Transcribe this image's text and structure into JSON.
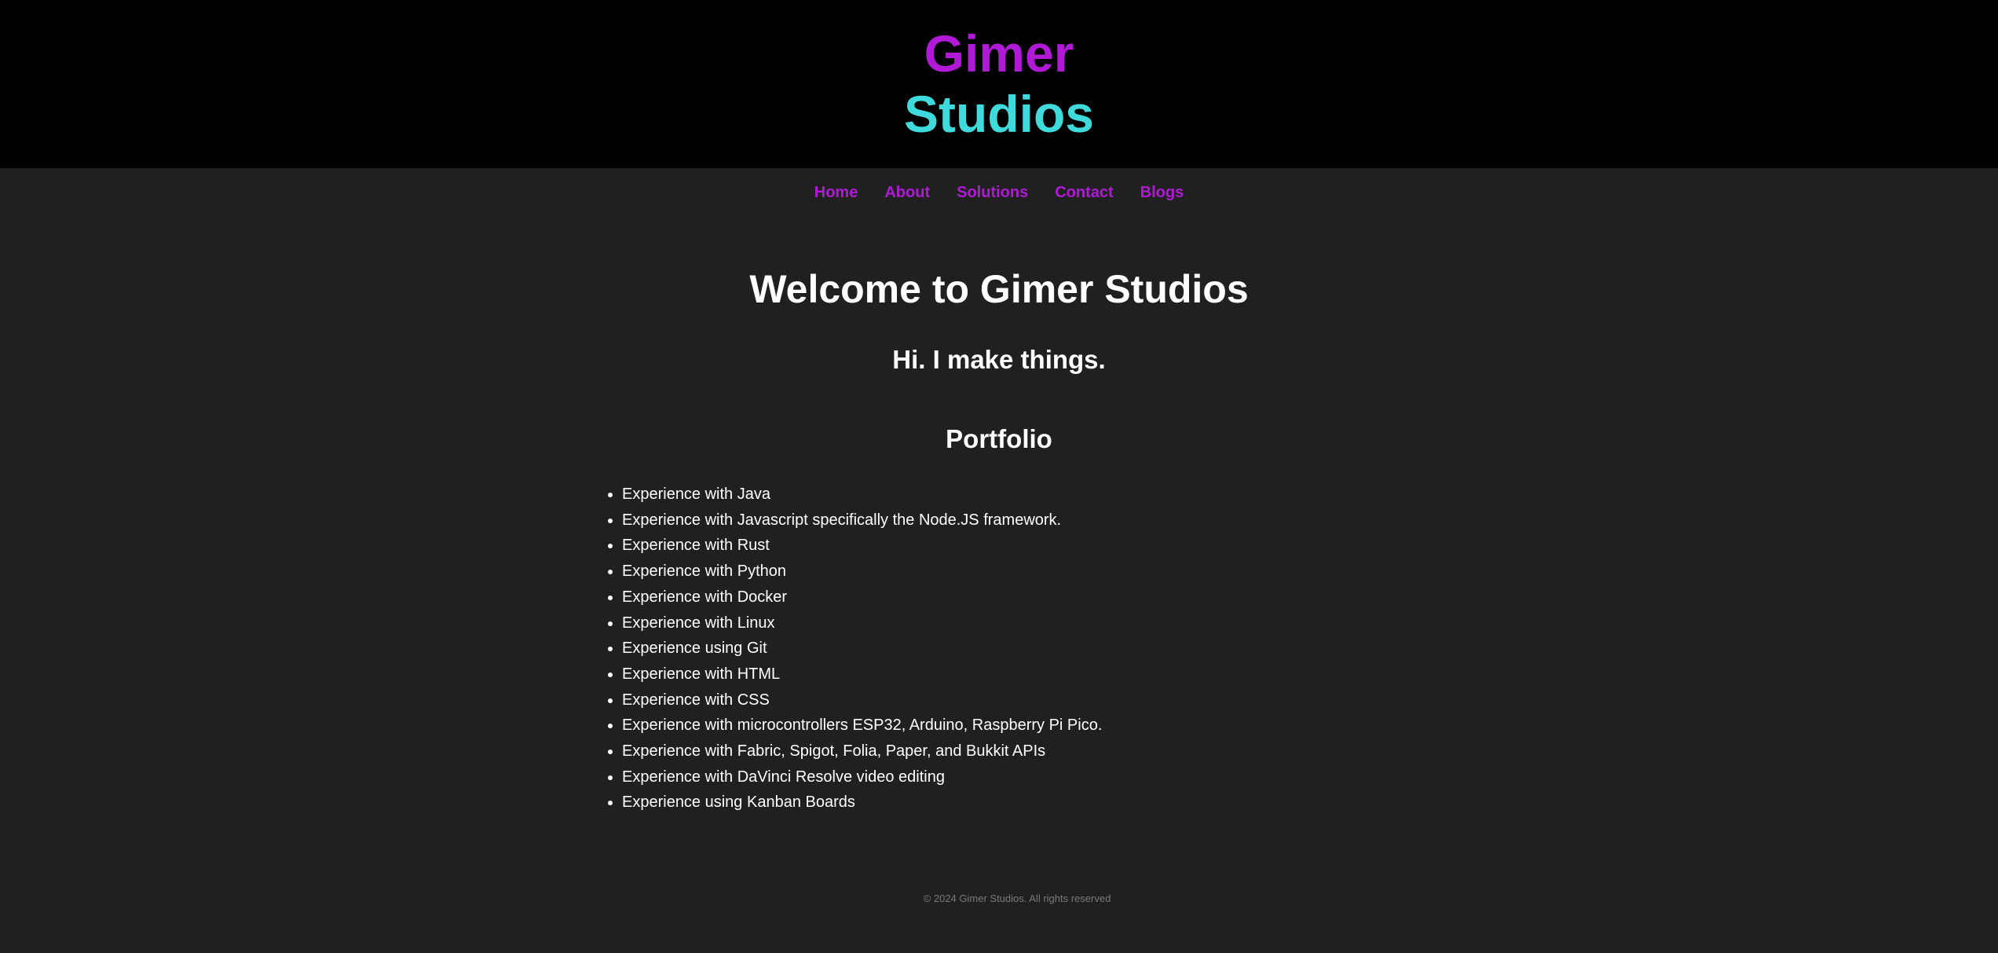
{
  "header": {
    "logo_line1": "Gimer",
    "logo_line2": "Studios",
    "logo_line1_color": "#b01ad6",
    "logo_line2_color": "#3fdbdc"
  },
  "nav": {
    "items": [
      {
        "label": "Home"
      },
      {
        "label": "About"
      },
      {
        "label": "Solutions"
      },
      {
        "label": "Contact"
      },
      {
        "label": "Blogs"
      }
    ],
    "link_color": "#b01ad6"
  },
  "main": {
    "title": "Welcome to Gimer Studios",
    "subtitle": "Hi. I make things.",
    "portfolio_heading": "Portfolio",
    "portfolio_items": [
      "Experience with Java",
      "Experience with Javascript specifically the Node.JS framework.",
      "Experience with Rust",
      "Experience with Python",
      "Experience with Docker",
      "Experience with Linux",
      "Experience using Git",
      "Experience with HTML",
      "Experience with CSS",
      "Experience with microcontrollers ESP32, Arduino, Raspberry Pi Pico.",
      "Experience with Fabric, Spigot, Folia, Paper, and Bukkit APIs",
      "Experience with DaVinci Resolve video editing",
      "Experience using Kanban Boards"
    ]
  },
  "footer": {
    "copyright": "© 2024 Gimer Studios. All rights reserved"
  },
  "colors": {
    "page_background": "#202020",
    "header_background": "#000000",
    "text": "#ffffff",
    "footer_text": "#7a7a7a"
  }
}
